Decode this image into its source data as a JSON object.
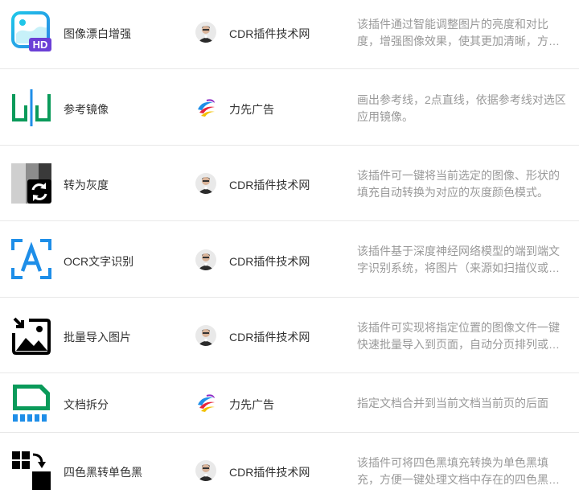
{
  "plugins": [
    {
      "name": "图像漂白增强",
      "icon": "hd-image-enhance-icon",
      "author": "CDR插件技术网",
      "author_avatar": "man-portrait-avatar",
      "description": "该插件通过智能调整图片的亮度和对比度，增强图像效果，使其更加清晰，方便处理更多的图像。"
    },
    {
      "name": "参考镜像",
      "icon": "reference-mirror-icon",
      "author": "力先广告",
      "author_avatar": "colorful-swirl-logo",
      "description": "画出参考线，2点直线，依据参考线对选区应用镜像。"
    },
    {
      "name": "转为灰度",
      "icon": "grayscale-convert-icon",
      "author": "CDR插件技术网",
      "author_avatar": "man-portrait-avatar",
      "description": "该插件可一键将当前选定的图像、形状的填充自动转换为对应的灰度颜色模式。"
    },
    {
      "name": "OCR文字识别",
      "icon": "ocr-scan-icon",
      "author": "CDR插件技术网",
      "author_avatar": "man-portrait-avatar",
      "description": "该插件基于深度神经网络模型的端到端文字识别系统，将图片（来源如扫描仪或数码相机）中的文字转换为可编辑的文本。"
    },
    {
      "name": "批量导入图片",
      "icon": "batch-import-image-icon",
      "author": "CDR插件技术网",
      "author_avatar": "man-portrait-avatar",
      "description": "该插件可实现将指定位置的图像文件一键快速批量导入到页面，自动分页排列或置入到指定的图框之中。"
    },
    {
      "name": "文档拆分",
      "icon": "document-split-icon",
      "author": "力先广告",
      "author_avatar": "colorful-swirl-logo",
      "description": "指定文档合并到当前文档当前页的后面"
    },
    {
      "name": "四色黑转单色黑",
      "icon": "four-color-black-icon",
      "author": "CDR插件技术网",
      "author_avatar": "man-portrait-avatar",
      "description": "该插件可将四色黑填充转换为单色黑填充，方便一键处理文档中存在的四色黑问题。"
    }
  ],
  "colors": {
    "icon_blue": "#1e8ee8",
    "icon_green": "#0a9a5a",
    "text": "#333333",
    "muted": "#999999",
    "divider": "#e8e8e8"
  }
}
